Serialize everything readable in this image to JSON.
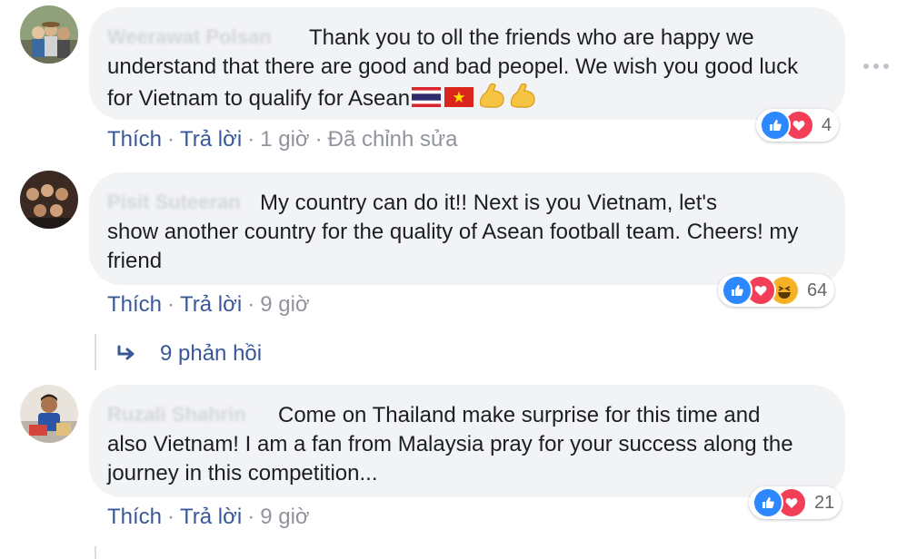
{
  "comments": [
    {
      "author": "Weerawat Polsan",
      "text_lead": "Thank you to oll the friends who are happy we",
      "text_rest": "understand that there are good and bad peopel. We wish you good luck for Vietnam to qualify for Asean",
      "reactions": [
        "like-icon",
        "love-icon"
      ],
      "reaction_count": "4",
      "like_label": "Thích",
      "reply_label": "Trả lời",
      "time": "1 giờ",
      "edited_label": "Đã chỉnh sửa"
    },
    {
      "author": "Pisit Suteeran",
      "text_lead": "My country can do it!! Next is you Vietnam, let's",
      "text_rest": "show another country for the quality of Asean football team. Cheers! my friend",
      "reactions": [
        "like-icon",
        "love-icon",
        "haha-icon"
      ],
      "reaction_count": "64",
      "like_label": "Thích",
      "reply_label": "Trả lời",
      "time": "9 giờ",
      "replies_label": "9 phản hồi"
    },
    {
      "author": "Ruzali Shahrin",
      "text_lead": "Come on Thailand make surprise for this time and",
      "text_rest": "also Vietnam! I am a fan from Malaysia pray for your success along the journey in this competition...",
      "reactions": [
        "like-icon",
        "love-icon"
      ],
      "reaction_count": "21",
      "like_label": "Thích",
      "reply_label": "Trả lời",
      "time": "9 giờ"
    }
  ],
  "colors": {
    "bubble": "#f2f3f5",
    "link": "#385898",
    "muted": "#90949c",
    "like": "#2d88ff",
    "love": "#f33e58",
    "haha": "#f7b125"
  }
}
